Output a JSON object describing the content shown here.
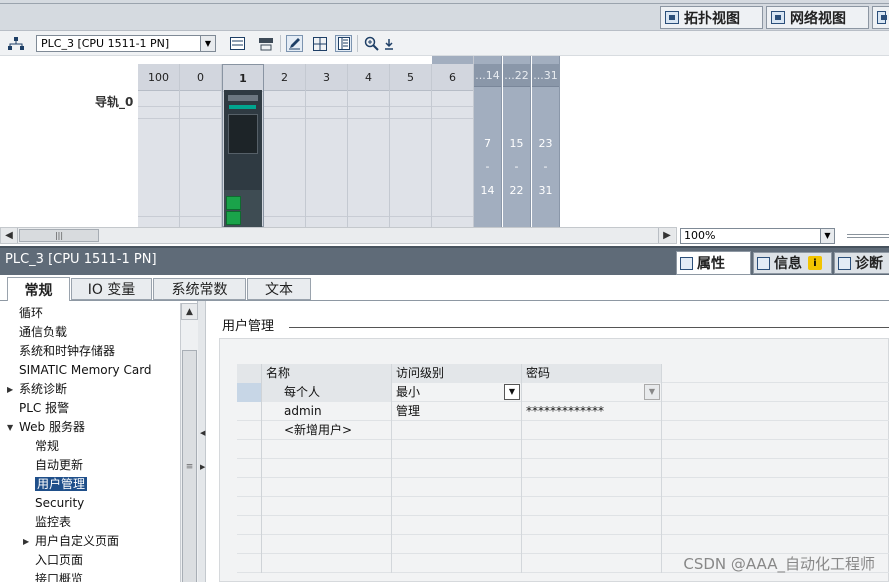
{
  "top_tabs": {
    "topology": "拓扑视图",
    "network": "网络视图"
  },
  "toolbar": {
    "device_select": "PLC_3 [CPU 1511-1 PN]"
  },
  "rack": {
    "label": "导轨_0",
    "slots": [
      "100",
      "0",
      "1",
      "2",
      "3",
      "4",
      "5",
      "6"
    ],
    "ext_slots": [
      {
        "header": "...14",
        "from": "7",
        "dash": "-",
        "to": "14"
      },
      {
        "header": "...22",
        "from": "15",
        "dash": "-",
        "to": "22"
      },
      {
        "header": "...31",
        "from": "23",
        "dash": "-",
        "to": "31"
      }
    ]
  },
  "zoom": {
    "value": "100%"
  },
  "inspector": {
    "title": "PLC_3 [CPU 1511-1 PN]",
    "tabs": {
      "properties": "属性",
      "info": "信息",
      "diagnostics": "诊断"
    },
    "subtabs": [
      "常规",
      "IO 变量",
      "系统常数",
      "文本"
    ]
  },
  "nav": {
    "items": [
      {
        "label": "循环",
        "indent": 0,
        "arrow": ""
      },
      {
        "label": "通信负载",
        "indent": 0,
        "arrow": ""
      },
      {
        "label": "系统和时钟存储器",
        "indent": 0,
        "arrow": ""
      },
      {
        "label": "SIMATIC Memory Card",
        "indent": 0,
        "arrow": ""
      },
      {
        "label": "系统诊断",
        "indent": 0,
        "arrow": "▶"
      },
      {
        "label": "PLC 报警",
        "indent": 0,
        "arrow": ""
      },
      {
        "label": "Web 服务器",
        "indent": 0,
        "arrow": "▼"
      },
      {
        "label": "常规",
        "indent": 1,
        "arrow": ""
      },
      {
        "label": "自动更新",
        "indent": 1,
        "arrow": ""
      },
      {
        "label": "用户管理",
        "indent": 1,
        "arrow": "",
        "selected": true
      },
      {
        "label": "Security",
        "indent": 1,
        "arrow": ""
      },
      {
        "label": "监控表",
        "indent": 1,
        "arrow": ""
      },
      {
        "label": "用户自定义页面",
        "indent": 1,
        "arrow": "▶"
      },
      {
        "label": "入口页面",
        "indent": 1,
        "arrow": ""
      },
      {
        "label": "接口概览",
        "indent": 1,
        "arrow": ""
      }
    ]
  },
  "content": {
    "section_title": "用户管理",
    "table": {
      "headers": [
        "名称",
        "访问级别",
        "密码"
      ],
      "rows": [
        {
          "name": "每个人",
          "access": "最小",
          "password": ""
        },
        {
          "name": "admin",
          "access": "管理",
          "password": "*************"
        },
        {
          "name": "<新增用户>",
          "access": "",
          "password": ""
        }
      ]
    }
  },
  "watermark": "CSDN @AAA_自动化工程师"
}
